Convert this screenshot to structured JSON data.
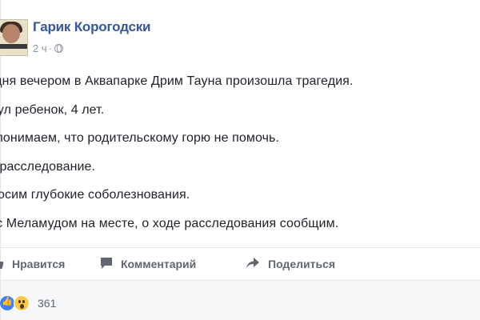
{
  "post": {
    "author": "Гарик Корогодски",
    "time": "2 ч",
    "privacy_icon": "globe-icon",
    "lines": [
      "годня вечером в Аквапарке Дрим Тауна произошла трагедия.",
      "онул ребенок, 4 лет.",
      "ы понимаем, что родительскому горю не помочь.",
      "ет расследование.",
      "иносим глубокие соболезнования.",
      "ы с Меламудом на месте, о ходе расследования сообщим."
    ]
  },
  "actions": {
    "like_label": "Нравится",
    "comment_label": "Комментарий",
    "share_label": "Поделиться"
  },
  "reactions": {
    "count": "361",
    "types": [
      "like-reaction",
      "wow-reaction"
    ]
  },
  "colors": {
    "author": "#365899",
    "action_text": "#616770",
    "like_blue": "#4080ff",
    "wow_yellow": "#f7c94d"
  }
}
